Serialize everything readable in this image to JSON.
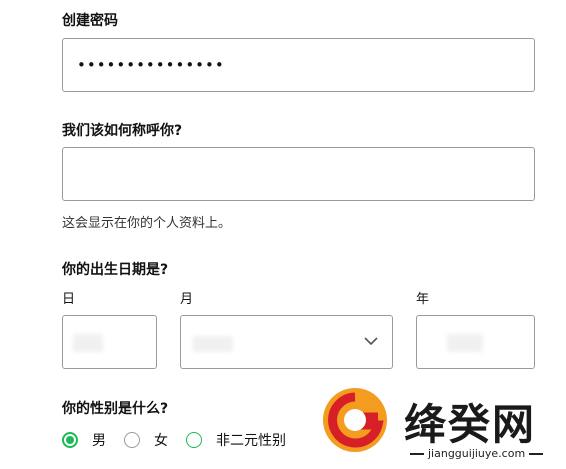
{
  "password": {
    "label": "创建密码",
    "value": "•••••••••••••••"
  },
  "name": {
    "label": "我们该如何称呼你?",
    "value": "",
    "hint": "这会显示在你的个人资料上。"
  },
  "dob": {
    "label": "你的出生日期是?",
    "day_label": "日",
    "month_label": "月",
    "year_label": "年"
  },
  "gender": {
    "label": "你的性别是什么?",
    "options": [
      "男",
      "女",
      "非二元性别"
    ],
    "selected": "男"
  },
  "watermark": {
    "brand": "绛癸网",
    "url": "jiangguijiuye.com"
  },
  "colors": {
    "accent": "#1db954",
    "border": "#9a9a9a"
  }
}
